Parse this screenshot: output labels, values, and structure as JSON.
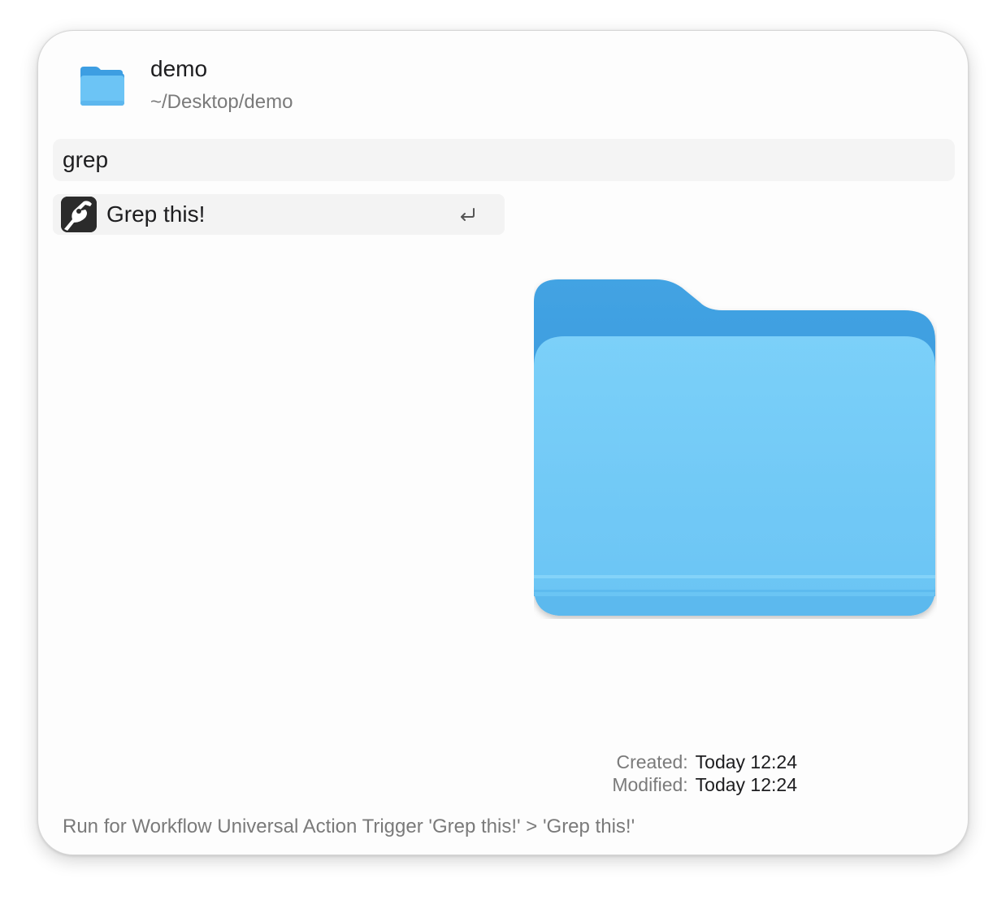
{
  "header": {
    "title": "demo",
    "path": "~/Desktop/demo",
    "icon": "folder-icon"
  },
  "search": {
    "value": "grep"
  },
  "results": [
    {
      "label": "Grep this!",
      "icon": "workflow-action-icon",
      "shortcut_icon": "return-icon",
      "selected": true
    }
  ],
  "preview": {
    "icon": "folder-icon",
    "created_label": "Created:",
    "created_value": "Today 12:24",
    "modified_label": "Modified:",
    "modified_value": "Today 12:24"
  },
  "footer": {
    "text": "Run for Workflow Universal Action Trigger 'Grep this!' > 'Grep this!'"
  },
  "colors": {
    "folder_back": "#3d9ee2",
    "folder_front": "#74cbf7",
    "row_highlight": "#f3f3f3",
    "search_bg": "#f4f4f4"
  }
}
